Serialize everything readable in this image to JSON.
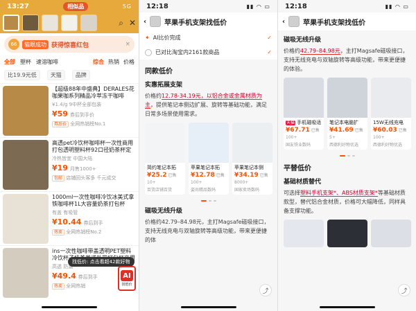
{
  "status": {
    "time1": "13:27",
    "time2": "12:18",
    "time3": "12:18",
    "pill": "相似品",
    "net": "5G"
  },
  "p1": {
    "promo": {
      "coin": "66",
      "tag": "猫眼成功",
      "text": "获得惊喜红包"
    },
    "cats": [
      "全部",
      "塑杯",
      "速溶咖啡"
    ],
    "sorts": [
      "综合",
      "热销",
      "价格"
    ],
    "filters": [
      "比19.9元低",
      "天猫",
      "品牌"
    ],
    "products": [
      {
        "title": "【超级88年中盛典】DERALES花咖果咖系列精品冷萃冻干咖啡2.1g",
        "meta": "¥1.4/g 9中杯全部包装",
        "price": "¥59",
        "sold": "券后到手价",
        "shop": "全网热销榜No.1",
        "badge": "券后价",
        "color": "#b88a48"
      },
      {
        "title": "高透pet冷饮杯咖啡杯一次性商用打包透明塑料杯92口径奶茶杯定制",
        "meta": "冷热皆宜 中国大陆",
        "price": "¥19",
        "sold": "月售1000+",
        "shop": "店铺回头客多 千元成交",
        "badge": "包邮",
        "color": "#7d6a52"
      },
      {
        "title": "1000ml一次性咖啡冷饮冰美式拿铁咖啡杯1L大容量奶茶打包杯",
        "meta": "有盖 有吸管",
        "price": "¥10.44",
        "sold": "券后到手",
        "shop": "全网热销榜No.2",
        "badge": "热卖",
        "color": "#e8e1d5"
      },
      {
        "title": "ins一次性咖啡带盖透明PET塑料冷饮杯子奶茶美式外带打包杯商用",
        "meta": "高透 防漏",
        "price": "¥49.4",
        "sold": "券后到手",
        "shop": "全网热销",
        "badge": "热卖",
        "color": "#d4ccbe"
      }
    ],
    "ai_tip": "找低价: 点击看超42款好物",
    "ai_label": "AI",
    "ai_sub": "找低价"
  },
  "p2": {
    "title": "苹果手机支架找低价",
    "step1": "AI比价完成",
    "step2": "已对比淘宝内2161款商品",
    "section": "同款低价",
    "sub1": "实惠拓展支架",
    "para1_a": "价格约",
    "para1_u": "12.78-34.19元，以铝合金或金属材质为主",
    "para1_b": "，提供笔记本侧边扩展、旋转等基础功能，满足日常多场景使用需求。",
    "cards": [
      {
        "name": "简约笔记本拓",
        "price": "¥25.2",
        "sold": "已售10+",
        "shop": "百货店铺百货",
        "img": "#f3f4f6"
      },
      {
        "name": "苹果笔记本拓",
        "price": "¥12.78",
        "sold": "已售100+",
        "shop": "姿尚精品数码",
        "img": "#e6eef8"
      },
      {
        "name": "苹果笔记本侧",
        "price": "¥34.19",
        "sold": "已售8000+",
        "shop": "国家卖场数码",
        "img": "#eceff2"
      }
    ],
    "sub2": "磁吸无线升级",
    "para2": "价格约42.79–84.98元，主打Magsafe磁吸接口，支持无线充电与双轴旋转等高级功能，带来更便捷的体"
  },
  "p3": {
    "title": "苹果手机支架找低价",
    "sub1": "磁吸无线升级",
    "para1_a": "价格约",
    "para1_u": "42.79–84.98元",
    "para1_b": "，主打Magsafe磁吸接口，支持无线充电与双轴旋转等高级功能，带来更便捷的体验。",
    "cards": [
      {
        "name": "手机磁吸适",
        "price": "¥67.71",
        "sold": "已售100+",
        "shop": "国友铁业数码",
        "img": "#d9dde3",
        "tm": "天猫"
      },
      {
        "name": "笔记本电脑扩",
        "price": "¥41.69",
        "sold": "已售5+",
        "shop": "西德利好物优选",
        "img": "#cfd4da"
      },
      {
        "name": "15W无线充电",
        "price": "¥60.03",
        "sold": "已售100+",
        "shop": "西德利好物优选",
        "img": "#e9ebee"
      }
    ],
    "section": "平替低价",
    "sub2": "基础材质替代",
    "para2_a": "可选择",
    "para2_u": "塑料手机支架*、ABS材质支架*",
    "para2_b": "等基础材质款型，替代铝合金材质，价格可大幅降低，同样具备支撑功能。"
  }
}
